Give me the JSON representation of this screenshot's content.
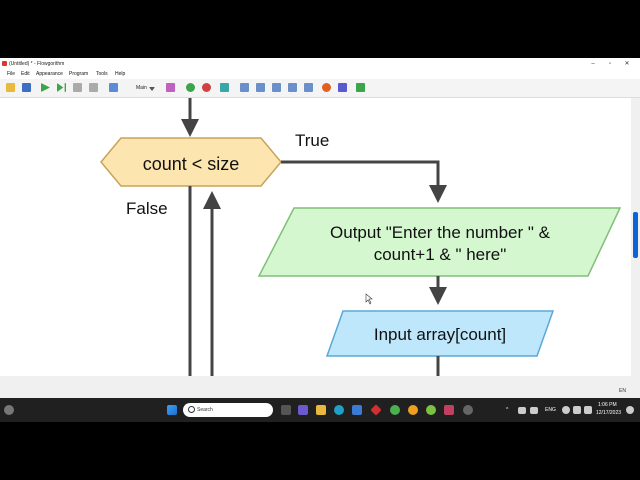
{
  "window": {
    "title": "(Untitled) * - Flowgorithm"
  },
  "menu": [
    "File",
    "Edit",
    "Appearance",
    "Program",
    "Tools",
    "Help"
  ],
  "toolbar": {
    "layout_label": "Main"
  },
  "flowchart": {
    "decision": "count < size",
    "true_label": "True",
    "false_label": "False",
    "output_line1": "Output \"Enter the number \" &",
    "output_line2": "count+1 & \" here\"",
    "input": "Input array[count]"
  },
  "statusbar": {
    "lang": "EN"
  },
  "taskbar": {
    "search_placeholder": "Search",
    "lang": "ENG",
    "time": "1:06 PM",
    "date": "12/17/2023"
  },
  "colors": {
    "decision_fill": "#fde5b0",
    "decision_stroke": "#c9a25c",
    "output_fill": "#d4f7cf",
    "output_stroke": "#7fbf78",
    "input_fill": "#bfe7fb",
    "input_stroke": "#5aa8d8",
    "arrow": "#444444"
  }
}
